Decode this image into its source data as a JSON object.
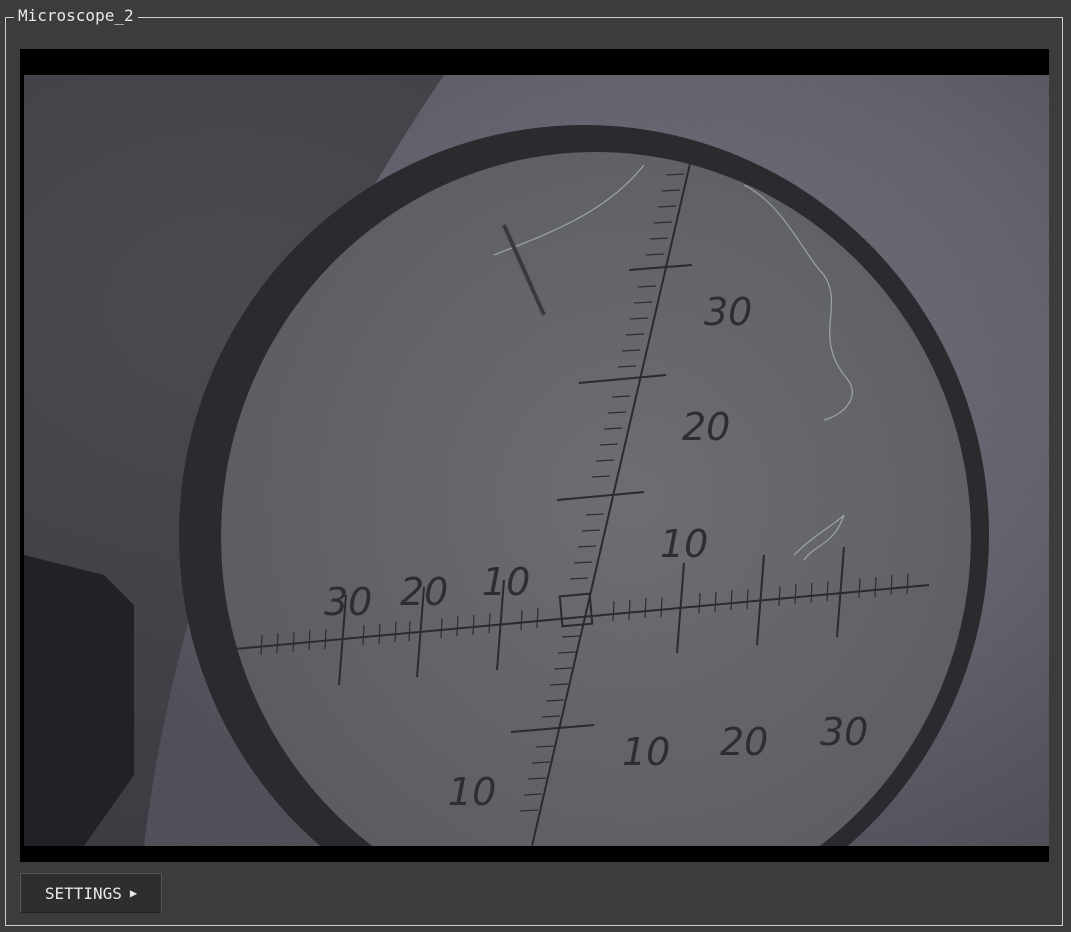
{
  "panel": {
    "title": "Microscope_2"
  },
  "camera_view": {
    "scale_labels": {
      "vertical_up": [
        "10",
        "20",
        "30"
      ],
      "vertical_down": [
        "10"
      ],
      "horizontal_left": [
        "10",
        "20",
        "30"
      ],
      "horizontal_right": [
        "10",
        "20",
        "30"
      ]
    }
  },
  "settings": {
    "label": "SETTINGS",
    "icon": "triangle-right-icon",
    "arrow_glyph": "▶"
  }
}
